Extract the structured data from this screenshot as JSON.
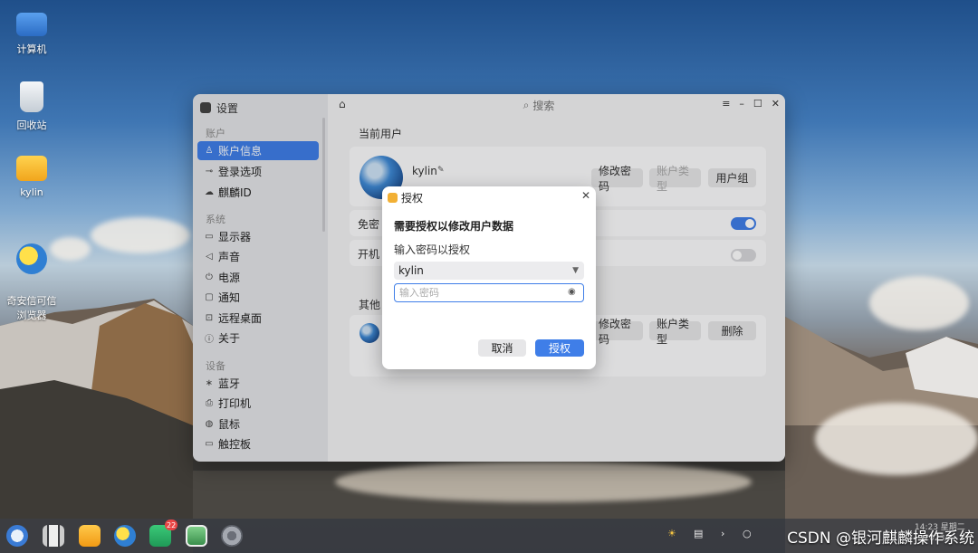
{
  "desktop": {
    "icons": [
      {
        "label": "计算机",
        "icon": "computer-icon"
      },
      {
        "label": "回收站",
        "icon": "recycle-bin-icon"
      },
      {
        "label": "kylin",
        "icon": "folder-icon"
      },
      {
        "label": "奇安信可信\n浏览器",
        "icon": "browser-icon"
      }
    ]
  },
  "settings": {
    "title": "设置",
    "search_placeholder": "搜索",
    "sidebar": {
      "groups": [
        {
          "label": "账户",
          "items": [
            {
              "label": "账户信息",
              "icon": "user-icon",
              "active": true
            },
            {
              "label": "登录选项",
              "icon": "key-icon"
            },
            {
              "label": "麒麟ID",
              "icon": "cloud-id-icon"
            }
          ]
        },
        {
          "label": "系统",
          "items": [
            {
              "label": "显示器",
              "icon": "monitor-icon"
            },
            {
              "label": "声音",
              "icon": "speaker-icon"
            },
            {
              "label": "电源",
              "icon": "power-icon"
            },
            {
              "label": "通知",
              "icon": "notification-icon"
            },
            {
              "label": "远程桌面",
              "icon": "remote-desktop-icon"
            },
            {
              "label": "关于",
              "icon": "info-icon"
            }
          ]
        },
        {
          "label": "设备",
          "items": [
            {
              "label": "蓝牙",
              "icon": "bluetooth-icon"
            },
            {
              "label": "打印机",
              "icon": "printer-icon"
            },
            {
              "label": "鼠标",
              "icon": "mouse-icon"
            },
            {
              "label": "触控板",
              "icon": "touchpad-icon"
            }
          ]
        }
      ]
    },
    "main": {
      "current_user_header": "当前用户",
      "current_user_name": "kylin",
      "change_password": "修改密码",
      "account_type": "账户类型",
      "user_group": "用户组",
      "row1_label": "免密",
      "row2_label": "开机",
      "other_users_header": "其他",
      "other_change_password": "修改密码",
      "other_account_type": "账户类型",
      "delete": "删除",
      "toggle1_on": true,
      "toggle2_on": false
    }
  },
  "auth_dialog": {
    "title": "授权",
    "heading": "需要授权以修改用户数据",
    "prompt": "输入密码以授权",
    "selected_user": "kylin",
    "password_placeholder": "输入密码",
    "cancel": "取消",
    "confirm": "授权"
  },
  "taskbar": {
    "apps": [
      "kylin-start-icon",
      "multitask-icon",
      "file-manager-icon",
      "browser-icon",
      "mail-icon",
      "image-viewer-icon",
      "settings-icon"
    ],
    "mail_badge": "22",
    "clock_time": "14:23 星期二",
    "clock_date": "2023/…"
  },
  "watermark": "CSDN @银河麒麟操作系统",
  "colors": {
    "accent": "#3f7ee8",
    "badge": "#e84545",
    "lock": "#f2b035"
  }
}
